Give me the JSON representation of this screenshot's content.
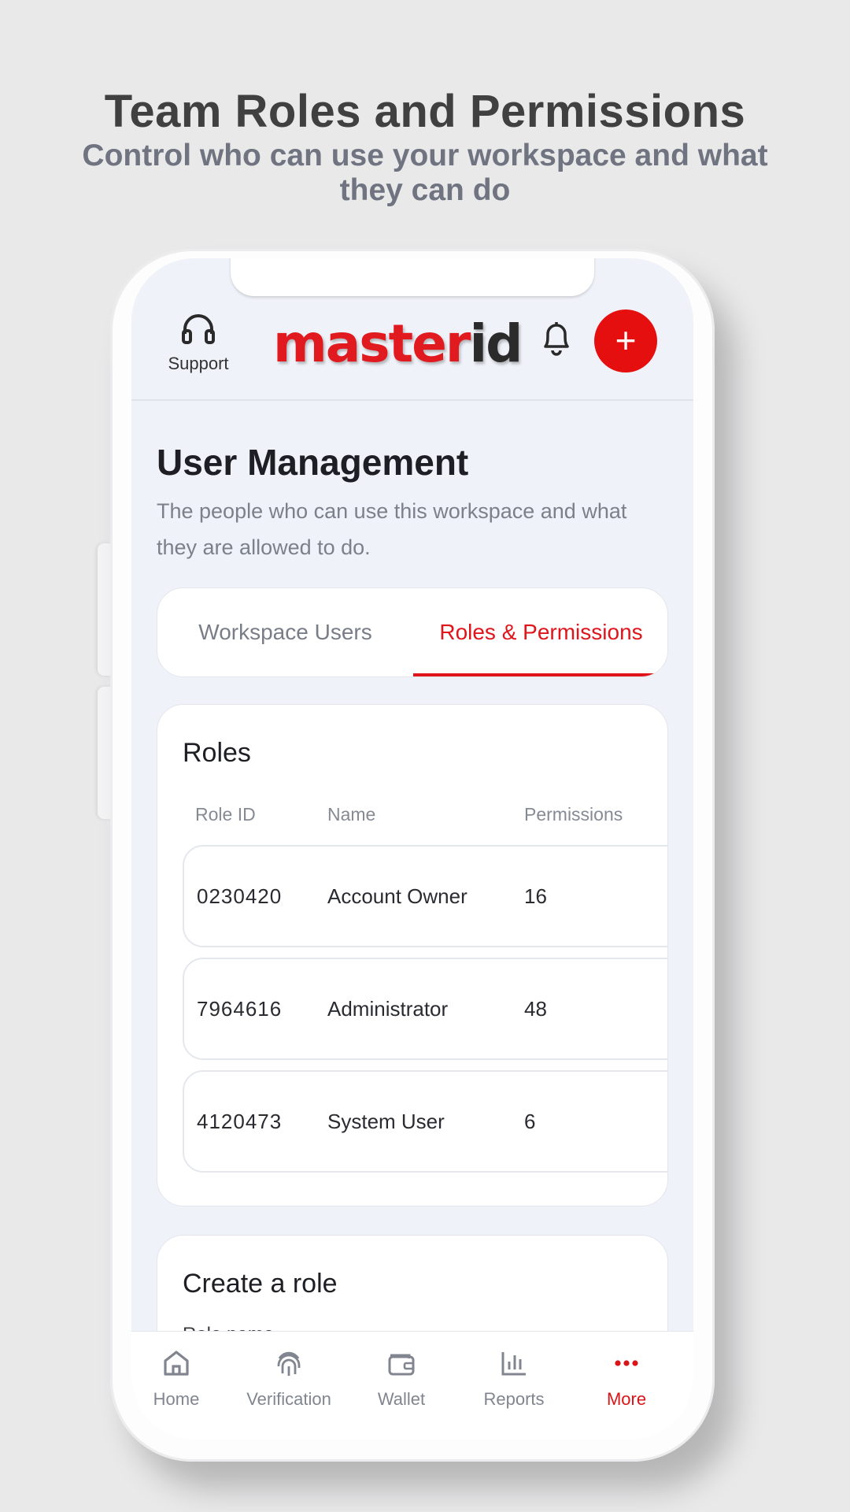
{
  "promo": {
    "headline": "Team Roles and Permissions",
    "subline": "Control who can use your workspace and what they can do"
  },
  "header": {
    "support_label": "Support",
    "logo_part1": "master",
    "logo_part2": "id",
    "add_label": "+"
  },
  "page": {
    "title": "User Management",
    "description": "The people who can use this workspace and what they are allowed to do."
  },
  "tabs": [
    {
      "label": "Workspace Users",
      "active": false
    },
    {
      "label": "Roles & Permissions",
      "active": true
    }
  ],
  "roles": {
    "title": "Roles",
    "columns": [
      "Role ID",
      "Name",
      "Permissions"
    ],
    "rows": [
      {
        "id": "0230420",
        "name": "Account Owner",
        "permissions": "16"
      },
      {
        "id": "7964616",
        "name": "Administrator",
        "permissions": "48"
      },
      {
        "id": "4120473",
        "name": "System User",
        "permissions": "6"
      }
    ]
  },
  "create_role": {
    "title": "Create a role",
    "field_label": "Role name"
  },
  "nav": [
    {
      "label": "Home",
      "icon": "home-icon"
    },
    {
      "label": "Verification",
      "icon": "fingerprint-icon"
    },
    {
      "label": "Wallet",
      "icon": "wallet-icon"
    },
    {
      "label": "Reports",
      "icon": "bar-chart-icon"
    },
    {
      "label": "More",
      "icon": "more-dots-icon",
      "active": true
    }
  ],
  "colors": {
    "accent": "#e0141b",
    "background": "#e9e9ea",
    "screen": "#eff2f8"
  }
}
